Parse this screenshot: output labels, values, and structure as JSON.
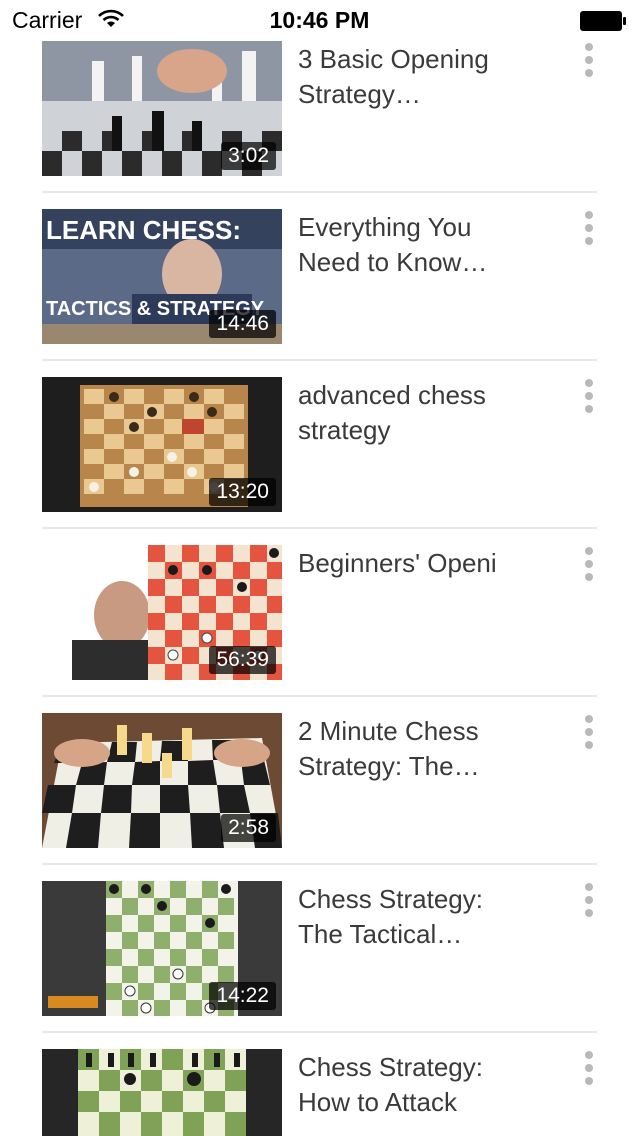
{
  "status_bar": {
    "carrier": "Carrier",
    "time": "10:46 PM",
    "icons": [
      "wifi-icon",
      "battery-icon"
    ]
  },
  "videos": [
    {
      "title_line1": "3 Basic Opening",
      "title_line2": "Strategy…",
      "duration": "3:02"
    },
    {
      "title_line1": "Everything You",
      "title_line2": "Need to Know…",
      "duration": "14:46",
      "thumb_text_top": "LEARN CHESS:",
      "thumb_text_bottom": "TACTICS & STRATEGY"
    },
    {
      "title_line1": "advanced chess",
      "title_line2": "strategy",
      "duration": "13:20"
    },
    {
      "title_line1": "Beginners' Openi",
      "title_line2": "",
      "duration": "56:39"
    },
    {
      "title_line1": "2 Minute Chess",
      "title_line2": "Strategy: The…",
      "duration": "2:58"
    },
    {
      "title_line1": "Chess Strategy:",
      "title_line2": "The Tactical…",
      "duration": "14:22"
    },
    {
      "title_line1": "Chess Strategy:",
      "title_line2": "How to Attack",
      "duration": ""
    }
  ],
  "colors": {
    "background": "#ffffff",
    "separator": "#e7e7e7",
    "title_text": "#3a3a3a",
    "menu_dots": "#b8b8b8"
  }
}
